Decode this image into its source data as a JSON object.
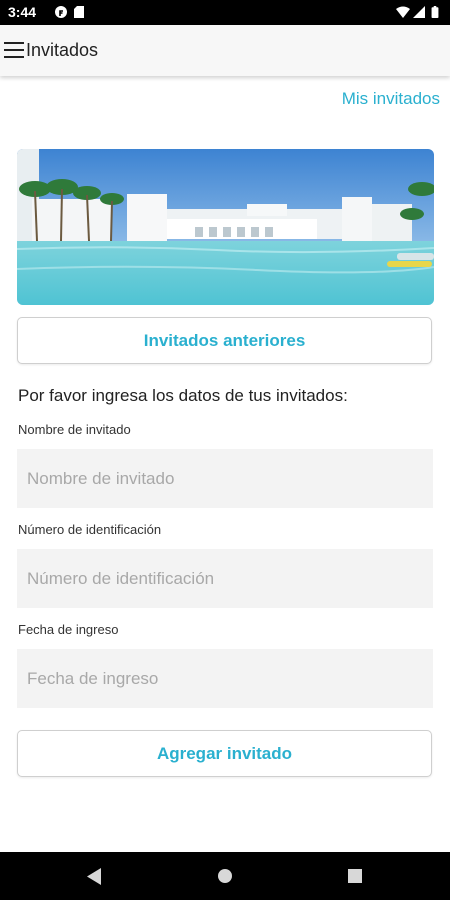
{
  "status_bar": {
    "time": "3:44",
    "left_icons": [
      "f-icon",
      "sd-card-icon"
    ],
    "right_icons": [
      "wifi-icon",
      "signal-icon",
      "battery-icon"
    ]
  },
  "app_bar": {
    "title": "Invitados",
    "menu_icon": "hamburger-menu-icon"
  },
  "header_link": "Mis invitados",
  "banner": {
    "kind": "resort pool photo"
  },
  "previous_guests_button": "Invitados anteriores",
  "instructions": "Por favor ingresa los datos de tus invitados:",
  "form": {
    "name": {
      "label": "Nombre de invitado",
      "placeholder": "Nombre de invitado",
      "value": ""
    },
    "id_number": {
      "label": "Número de identificación",
      "placeholder": "Número de identificación",
      "value": ""
    },
    "entry_date": {
      "label": "Fecha de ingreso",
      "placeholder": "Fecha de ingreso",
      "value": ""
    }
  },
  "add_guest_button": "Agregar invitado",
  "nav_bar": {
    "icons": [
      "back-icon",
      "home-icon",
      "recents-icon"
    ]
  },
  "colors": {
    "accent": "#2ab0cf",
    "field_background": "#f3f3f3",
    "app_bar": "#f7f7f7"
  }
}
